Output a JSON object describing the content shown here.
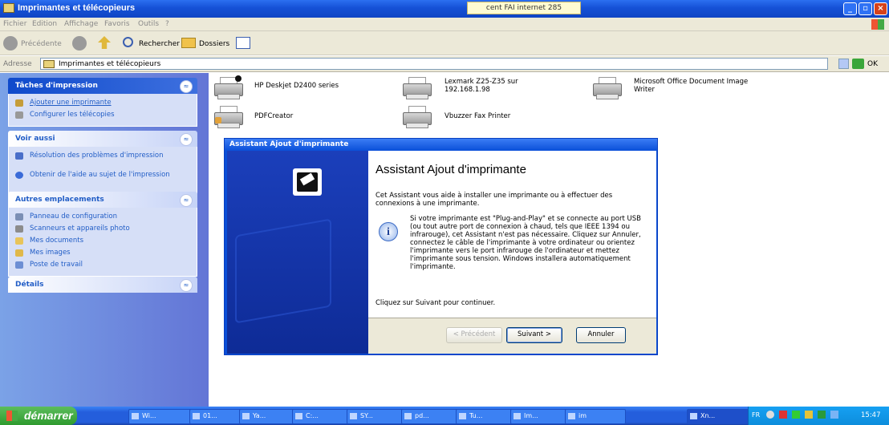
{
  "window": {
    "title": "Imprimantes et télécopieurs",
    "connection": "cent FAI internet 285",
    "min_label": "_",
    "max_label": "▫",
    "close_label": "×"
  },
  "menu": [
    "Fichier",
    "Edition",
    "Affichage",
    "Favoris",
    "Outils",
    "?"
  ],
  "toolbar": {
    "back": "Précédente",
    "search": "Rechercher",
    "folders": "Dossiers"
  },
  "address": {
    "label": "Adresse",
    "value": "Imprimantes et télécopieurs",
    "go": "OK"
  },
  "sidebar": {
    "print_tasks": {
      "title": "Tâches d'impression",
      "items": [
        "Ajouter une imprimante",
        "Configurer les télécopies"
      ]
    },
    "see_also": {
      "title": "Voir aussi",
      "items": [
        "Résolution des problèmes d'impression",
        "Obtenir de l'aide au sujet de l'impression"
      ]
    },
    "other_places": {
      "title": "Autres emplacements",
      "items": [
        "Panneau de configuration",
        "Scanneurs et appareils photo",
        "Mes documents",
        "Mes images",
        "Poste de travail"
      ]
    },
    "details": {
      "title": "Détails"
    }
  },
  "printers": [
    {
      "name": "HP Deskjet D2400 series"
    },
    {
      "name": "Lexmark Z25-Z35 sur 192.168.1.98"
    },
    {
      "name": "Microsoft Office Document Image Writer"
    },
    {
      "name": "PDFCreator"
    },
    {
      "name": "Vbuzzer Fax Printer"
    }
  ],
  "dialog": {
    "title": "Assistant Ajout d'imprimante",
    "heading": "Assistant Ajout d'imprimante",
    "intro": "Cet Assistant vous aide à installer une imprimante ou à effectuer des connexions à une imprimante.",
    "info": "Si votre imprimante est \"Plug-and-Play\" et se connecte au port USB (ou tout autre port de connexion à chaud, tels que IEEE 1394 ou infrarouge), cet Assistant n'est pas nécessaire. Cliquez sur Annuler, connectez le câble de l'imprimante à votre ordinateur ou orientez l'imprimante vers le port infrarouge de l'ordinateur et mettez l'imprimante sous tension. Windows installera automatiquement l'imprimante.",
    "continue": "Cliquez sur Suivant pour continuer.",
    "btn_prev": "< Précédent",
    "btn_next": "Suivant >",
    "btn_cancel": "Annuler"
  },
  "taskbar": {
    "start": "démarrer",
    "tasks": [
      "Wi...",
      "01...",
      "Ya...",
      "C:...",
      "SY...",
      "pd...",
      "Tu...",
      "Im...",
      "im",
      "Xn..."
    ],
    "lang": "FR",
    "clock": "15:47"
  }
}
